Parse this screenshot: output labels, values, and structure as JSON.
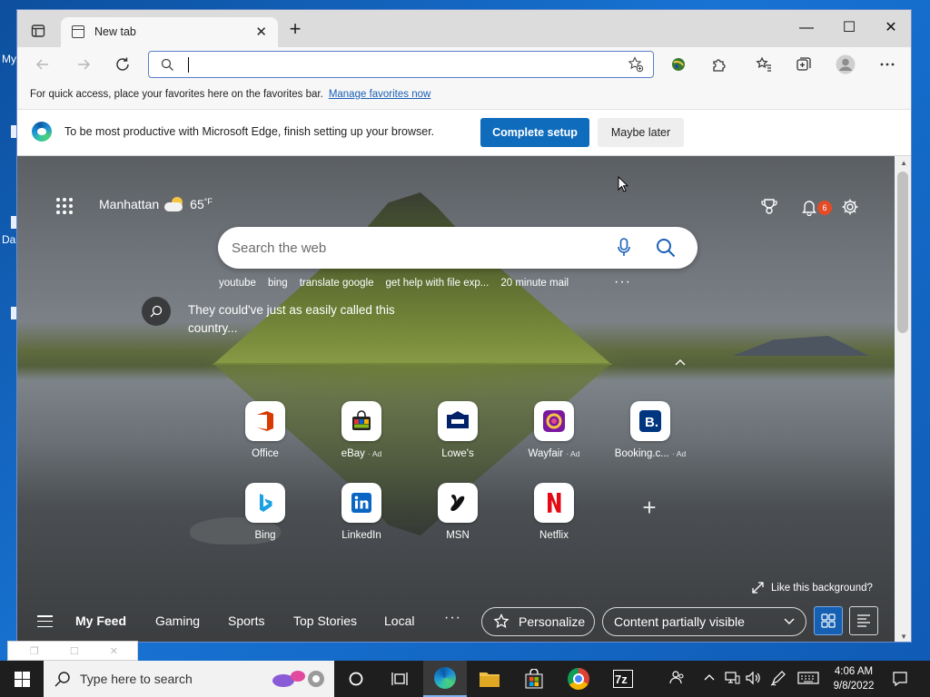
{
  "browser": {
    "tab": {
      "title": "New tab",
      "close": "✕"
    },
    "new_tab": "+",
    "window_controls": {
      "minimize": "—",
      "maximize": "☐",
      "close": "✕"
    },
    "address_bar": {
      "value": "",
      "placeholder": ""
    },
    "favorites_bar": {
      "message": "For quick access, place your favorites here on the favorites bar.",
      "link": "Manage favorites now"
    },
    "infobar": {
      "message": "To be most productive with Microsoft Edge, finish setting up your browser.",
      "primary": "Complete setup",
      "secondary": "Maybe later"
    }
  },
  "ntp": {
    "weather": {
      "location": "Manhattan",
      "temp": "65",
      "unit": "°F"
    },
    "notifications_count": "6",
    "search": {
      "placeholder": "Search the web"
    },
    "quick_searches": [
      "youtube",
      "bing",
      "translate google",
      "get help with file exp...",
      "20 minute mail"
    ],
    "more": "···",
    "trending": "They could've just as easily called this country...",
    "tiles": [
      {
        "label": "Office",
        "ad": "",
        "icon": "office-icon",
        "color": "#d83b01"
      },
      {
        "label": "eBay",
        "ad": "· Ad",
        "icon": "ebay-bag-icon",
        "color": "#3b3b3b"
      },
      {
        "label": "Lowe's",
        "ad": "",
        "icon": "lowes-icon",
        "color": "#012169"
      },
      {
        "label": "Wayfair",
        "ad": "· Ad",
        "icon": "wayfair-icon",
        "color": "#7b189f"
      },
      {
        "label": "Booking.c...",
        "ad": "· Ad",
        "icon": "booking-icon",
        "color": "#003580"
      },
      {
        "label": "Bing",
        "ad": "",
        "icon": "bing-icon",
        "color": "#1ba1e2"
      },
      {
        "label": "LinkedIn",
        "ad": "",
        "icon": "linkedin-icon",
        "color": "#0a66c2"
      },
      {
        "label": "MSN",
        "ad": "",
        "icon": "msn-icon",
        "color": "#111111"
      },
      {
        "label": "Netflix",
        "ad": "",
        "icon": "netflix-icon",
        "color": "#e50914"
      }
    ],
    "add_tile": "+",
    "like_background": "Like this background?",
    "feed": {
      "tabs": [
        "My Feed",
        "Gaming",
        "Sports",
        "Top Stories",
        "Local"
      ],
      "more": "···",
      "personalize": "Personalize",
      "content_visibility": "Content partially visible"
    }
  },
  "taskbar": {
    "search_placeholder": "Type here to search",
    "clock_time": "4:06 AM",
    "clock_date": "9/8/2022"
  },
  "desktop": {
    "fragments": [
      "My",
      "Da"
    ]
  },
  "colors": {
    "accent": "#0f6cbd",
    "taskbar": "#1e1e1e",
    "badge": "#e34c26"
  }
}
